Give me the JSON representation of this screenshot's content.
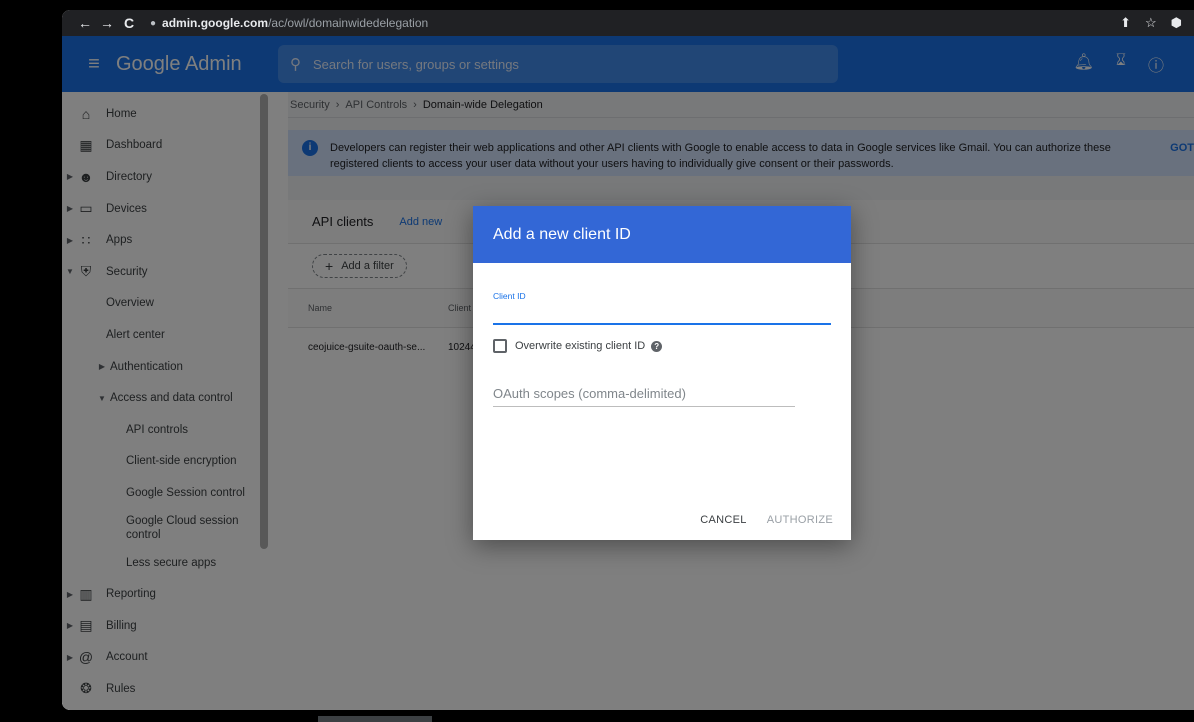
{
  "browser": {
    "back": "←",
    "forward": "→",
    "reload": "C",
    "host": "admin.google.com",
    "path": "/ac/owl/domainwidedelegation"
  },
  "appbar": {
    "logo": "Google Admin",
    "search_placeholder": "Search for users, groups or settings"
  },
  "sidebar": {
    "items": [
      {
        "label": "Home"
      },
      {
        "label": "Dashboard"
      },
      {
        "label": "Directory"
      },
      {
        "label": "Devices"
      },
      {
        "label": "Apps"
      },
      {
        "label": "Security"
      },
      {
        "label": "Overview"
      },
      {
        "label": "Alert center"
      },
      {
        "label": "Authentication"
      },
      {
        "label": "Access and data control"
      },
      {
        "label": "API controls"
      },
      {
        "label": "Client-side encryption"
      },
      {
        "label": "Google Session control"
      },
      {
        "label": "Google Cloud session control"
      },
      {
        "label": "Less secure apps"
      },
      {
        "label": "Reporting"
      },
      {
        "label": "Billing"
      },
      {
        "label": "Account"
      },
      {
        "label": "Rules"
      }
    ]
  },
  "breadcrumb": {
    "security": "Security",
    "api_controls": "API Controls",
    "current": "Domain-wide Delegation"
  },
  "info": {
    "text": "Developers can register their web applications and other API clients with Google to enable access to data in Google services like Gmail. You can authorize these registered clients to access your user data without your users having to individually give consent or their passwords.",
    "link": "GOT"
  },
  "card": {
    "title": "API clients",
    "add_new": "Add new",
    "add_filter": "Add a filter",
    "columns": {
      "name": "Name",
      "client": "Client"
    },
    "rows": [
      {
        "name": "ceojuice-gsuite-oauth-se...",
        "client": "10244"
      }
    ]
  },
  "dialog": {
    "title": "Add a new client ID",
    "client_id_label": "Client ID",
    "client_id_value": "",
    "overwrite_label": "Overwrite existing client ID",
    "scopes_placeholder": "OAuth scopes (comma-delimited)",
    "cancel": "CANCEL",
    "authorize": "AUTHORIZE"
  }
}
